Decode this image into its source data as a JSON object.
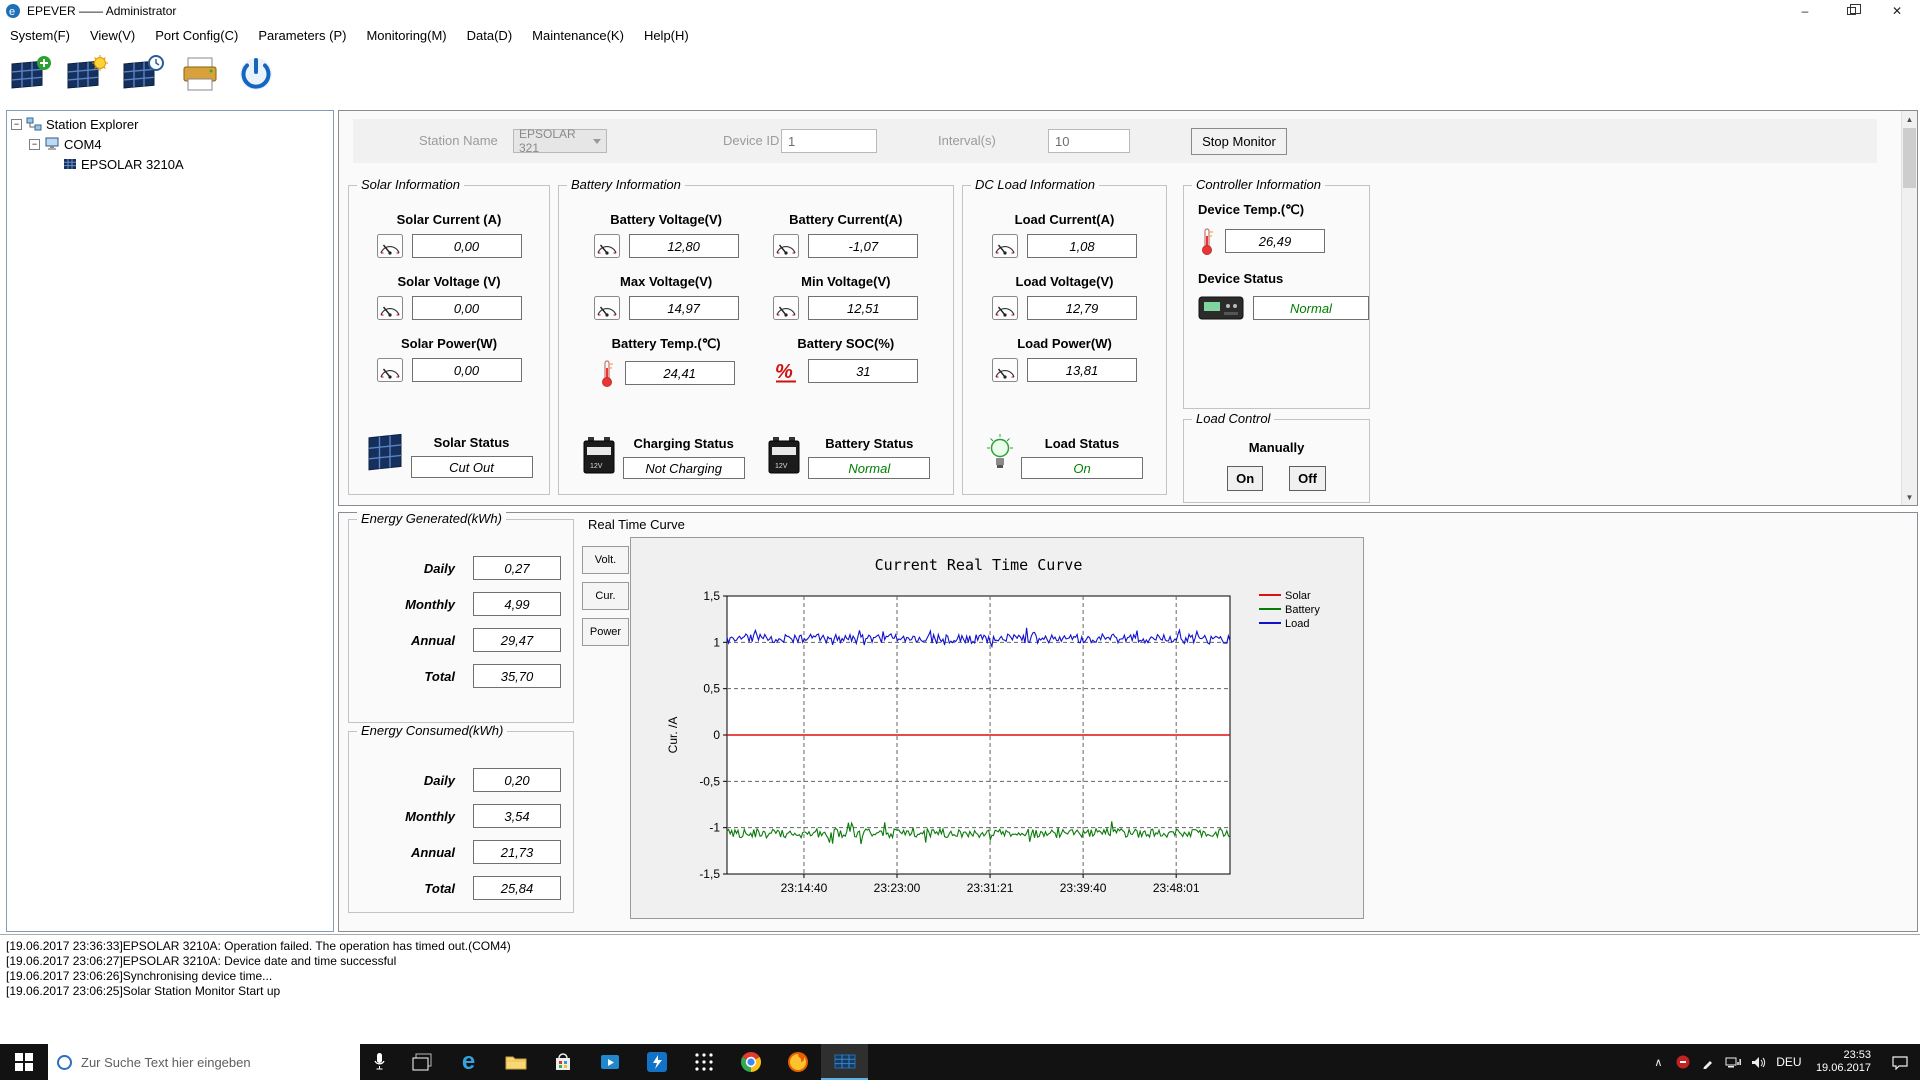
{
  "window": {
    "title": "EPEVER —— Administrator"
  },
  "menu": {
    "items": [
      "System(F)",
      "View(V)",
      "Port Config(C)",
      "Parameters (P)",
      "Monitoring(M)",
      "Data(D)",
      "Maintenance(K)",
      "Help(H)"
    ]
  },
  "toolbar": {
    "buttons": [
      {
        "name": "add-station-button",
        "icon": "tool-add"
      },
      {
        "name": "station-settings-button",
        "icon": "tool-sun"
      },
      {
        "name": "station-timer-button",
        "icon": "tool-clock"
      },
      {
        "name": "print-button",
        "icon": "tool-print"
      },
      {
        "name": "power-button",
        "icon": "tool-power"
      }
    ]
  },
  "tree": {
    "items": [
      {
        "label": "Station Explorer",
        "icon": "network",
        "expander": true,
        "indent": 4
      },
      {
        "label": "COM4",
        "icon": "com-port",
        "expander": true,
        "indent": 22
      },
      {
        "label": "EPSOLAR 3210A",
        "icon": "device",
        "expander": false,
        "indent": 56
      }
    ]
  },
  "monitor_bar": {
    "station_name_label": "Station Name",
    "station_name": "EPSOLAR 321",
    "device_id_label": "Device ID",
    "device_id": "1",
    "interval_label": "Interval(s)",
    "interval": "10",
    "stop_button_label": "Stop Monitor"
  },
  "panels": [
    {
      "id": "solar",
      "title": "Solar Information",
      "columns": [
        [
          {
            "label": "Solar Current (A)",
            "value": "0,00",
            "icon": "meter"
          },
          {
            "label": "Solar Voltage (V)",
            "value": "0,00",
            "icon": "meter"
          },
          {
            "label": "Solar Power(W)",
            "value": "0,00",
            "icon": "meter"
          }
        ]
      ],
      "statuses": [
        {
          "label": "Solar Status",
          "value": "Cut Out",
          "icon": "solar-panel",
          "color": "#000000"
        }
      ]
    },
    {
      "id": "battery",
      "title": "Battery Information",
      "columns": [
        [
          {
            "label": "Battery Voltage(V)",
            "value": "12,80",
            "icon": "meter"
          },
          {
            "label": "Max Voltage(V)",
            "value": "14,97",
            "icon": "meter"
          },
          {
            "label": "Battery Temp.(℃)",
            "value": "24,41",
            "icon": "thermometer"
          }
        ],
        [
          {
            "label": "Battery Current(A)",
            "value": "-1,07",
            "icon": "meter"
          },
          {
            "label": "Min Voltage(V)",
            "value": "12,51",
            "icon": "meter"
          },
          {
            "label": "Battery SOC(%)",
            "value": "31",
            "icon": "percent"
          }
        ]
      ],
      "statuses": [
        {
          "label": "Charging Status",
          "value": "Not Charging",
          "icon": "battery",
          "color": "#000000"
        },
        {
          "label": "Battery Status",
          "value": "Normal",
          "icon": "battery",
          "color": "#008000"
        }
      ]
    },
    {
      "id": "load",
      "title": "DC Load Information",
      "columns": [
        [
          {
            "label": "Load Current(A)",
            "value": "1,08",
            "icon": "meter"
          },
          {
            "label": "Load Voltage(V)",
            "value": "12,79",
            "icon": "meter"
          },
          {
            "label": "Load Power(W)",
            "value": "13,81",
            "icon": "meter"
          }
        ]
      ],
      "statuses": [
        {
          "label": "Load Status",
          "value": "On",
          "icon": "bulb",
          "color": "#008000"
        }
      ]
    }
  ],
  "controller": {
    "title": "Controller Information",
    "temp_label": "Device Temp.(℃)",
    "temp_value": "26,49",
    "status_label": "Device Status",
    "status_value": "Normal",
    "status_color": "#008000"
  },
  "load_control": {
    "title": "Load Control",
    "manually_label": "Manually",
    "on_label": "On",
    "off_label": "Off"
  },
  "energy_generated": {
    "title": "Energy Generated(kWh)",
    "rows": [
      {
        "label": "Daily",
        "value": "0,27"
      },
      {
        "label": "Monthly",
        "value": "4,99"
      },
      {
        "label": "Annual",
        "value": "29,47"
      },
      {
        "label": "Total",
        "value": "35,70"
      }
    ]
  },
  "energy_consumed": {
    "title": "Energy Consumed(kWh)",
    "rows": [
      {
        "label": "Daily",
        "value": "0,20"
      },
      {
        "label": "Monthly",
        "value": "3,54"
      },
      {
        "label": "Annual",
        "value": "21,73"
      },
      {
        "label": "Total",
        "value": "25,84"
      }
    ]
  },
  "rtc": {
    "section_label": "Real Time Curve",
    "tabs": [
      "Volt.",
      "Cur.",
      "Power"
    ]
  },
  "chart_data": {
    "type": "line",
    "title": "Current Real Time Curve",
    "ylabel": "Cur. /A",
    "ylim": [
      -1.5,
      1.5
    ],
    "ytick_labels": [
      "1,5",
      "1",
      "0,5",
      "0",
      "-0,5",
      "-1",
      "-1,5"
    ],
    "xtick_labels": [
      "23:14:40",
      "23:23:00",
      "23:31:21",
      "23:39:40",
      "23:48:01"
    ],
    "xtick_fractions": [
      0.153,
      0.338,
      0.523,
      0.708,
      0.893
    ],
    "grid": true,
    "legend_position": "right-top",
    "points": 320,
    "series": [
      {
        "name": "Solar",
        "color": "#dd1111",
        "base": 0,
        "noise": 0
      },
      {
        "name": "Battery",
        "color": "#0a7a0a",
        "base": -1.06,
        "noise": 0.05
      },
      {
        "name": "Load",
        "color": "#1111cc",
        "base": 1.04,
        "noise": 0.05
      }
    ]
  },
  "log": {
    "lines": [
      "[19.06.2017 23:36:33]EPSOLAR 3210A: Operation failed. The operation has timed out.(COM4)",
      "[19.06.2017 23:06:27]EPSOLAR 3210A: Device date and time successful",
      "[19.06.2017 23:06:26]Synchronising device time...",
      "[19.06.2017 23:06:25]Solar Station Monitor Start up"
    ]
  },
  "taskbar": {
    "search_placeholder": "Zur Suche Text hier eingeben",
    "app_icons": [
      "task-view",
      "edge",
      "explorer",
      "store",
      "video",
      "mail-app",
      "grid",
      "chrome",
      "firefox",
      "epever-active"
    ],
    "active_icon": "epever-active",
    "tray_icons": [
      "chevron-up",
      "alert-red",
      "pen",
      "network",
      "volume"
    ],
    "lang": "DEU",
    "time": "23:53",
    "date": "19.06.2017"
  }
}
